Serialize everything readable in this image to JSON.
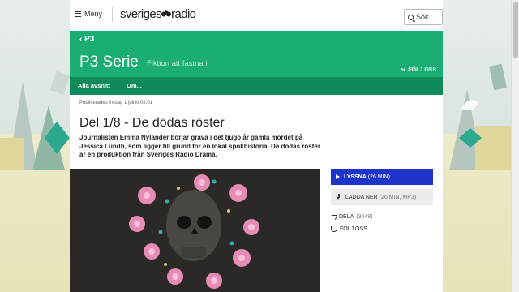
{
  "header": {
    "menu_label": "Meny",
    "brand": "sveriges",
    "brand_suffix": "radio",
    "search_label": "Sök"
  },
  "channel": {
    "back_label": "P3",
    "program_title": "P3 Serie",
    "tagline": "Fiktion att fastna i",
    "follow_label": "FÖLJ OSS"
  },
  "subnav": {
    "items": [
      "Alla avsnitt",
      "Om..."
    ]
  },
  "article": {
    "published": "Publicerades fredag 1 juli kl 08.01",
    "title": "Del 1/8 - De dödas röster",
    "lead": "Journalisten Emma Nylander börjar gräva i det tjugo år gamla mordet på Jessica Lundh, som ligger till grund för en lokal spökhistoria. De dödas röster är en produktion från Sveriges Radio Drama."
  },
  "actions": {
    "listen_label": "LYSSNA",
    "listen_meta": "(26 MIN)",
    "download_label": "LADDA NER",
    "download_meta": "(26 MIN, MP3)",
    "share_label": "DELA",
    "share_count": "(3048)",
    "follow_label": "FÖLJ OSS"
  },
  "colors": {
    "channel_green": "#1aae75",
    "subnav_green": "#0f8a5b",
    "listen_blue": "#1d33c9"
  },
  "icons": [
    "hamburger-icon",
    "search-icon",
    "play-icon",
    "download-icon",
    "share-icon",
    "follow-icon",
    "srad-logo-icon"
  ]
}
